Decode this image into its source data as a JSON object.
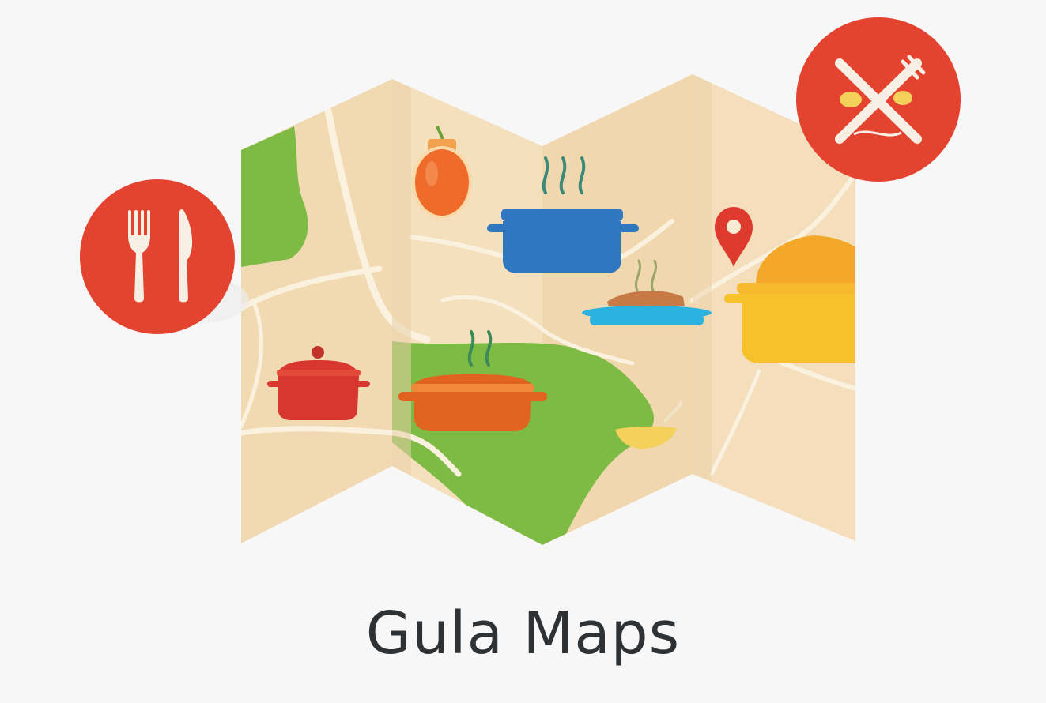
{
  "app": {
    "title": "Gula Maps"
  },
  "colors": {
    "background": "#f7f7f7",
    "map_paper": "#f3dcb6",
    "map_paper_dark": "#e8cfa8",
    "park_green": "#7dbb45",
    "road": "#fbf1df",
    "badge_red": "#e4442f",
    "utensil_white": "#f7efe4",
    "pin_red": "#df3a2e",
    "pot_blue": "#2f78c0",
    "pot_red": "#d8372f",
    "pot_orange": "#e2621f",
    "pot_yellow": "#f6c12b",
    "plate_cyan": "#2ab3e0",
    "jar_orange": "#ef6b2a",
    "title_text": "#2f3234"
  },
  "icons": [
    "fork-knife-icon",
    "crossed-utensils-icon",
    "location-pin-icon",
    "blue-pot-icon",
    "red-pot-icon",
    "orange-pot-icon",
    "yellow-pot-icon",
    "plate-icon",
    "jar-icon",
    "bowl-icon"
  ]
}
